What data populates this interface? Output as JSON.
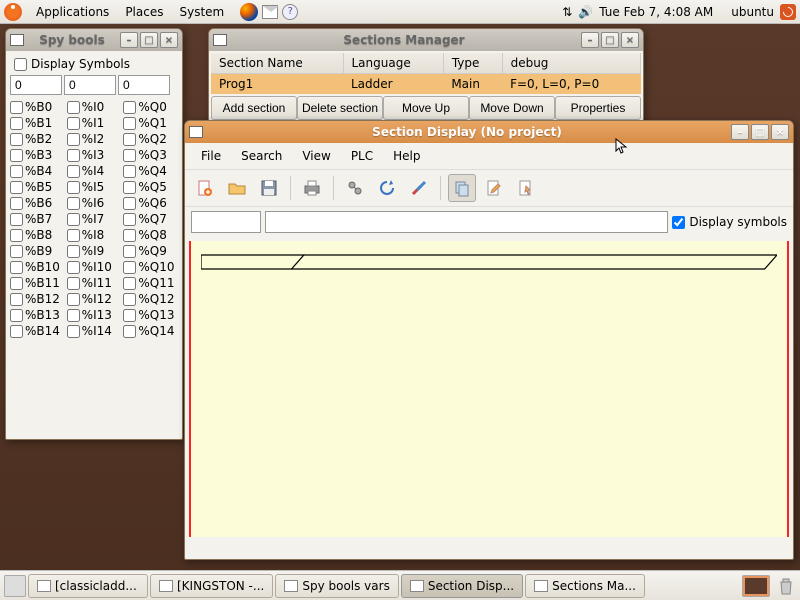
{
  "panel": {
    "menus": [
      "Applications",
      "Places",
      "System"
    ],
    "clock": "Tue Feb  7,  4:08 AM",
    "user": "ubuntu"
  },
  "spy": {
    "title": "Spy bools",
    "display_symbols": "Display Symbols",
    "inputs": [
      "0",
      "0",
      "0"
    ],
    "rows": [
      [
        "%B0",
        "%I0",
        "%Q0"
      ],
      [
        "%B1",
        "%I1",
        "%Q1"
      ],
      [
        "%B2",
        "%I2",
        "%Q2"
      ],
      [
        "%B3",
        "%I3",
        "%Q3"
      ],
      [
        "%B4",
        "%I4",
        "%Q4"
      ],
      [
        "%B5",
        "%I5",
        "%Q5"
      ],
      [
        "%B6",
        "%I6",
        "%Q6"
      ],
      [
        "%B7",
        "%I7",
        "%Q7"
      ],
      [
        "%B8",
        "%I8",
        "%Q8"
      ],
      [
        "%B9",
        "%I9",
        "%Q9"
      ],
      [
        "%B10",
        "%I10",
        "%Q10"
      ],
      [
        "%B11",
        "%I11",
        "%Q11"
      ],
      [
        "%B12",
        "%I12",
        "%Q12"
      ],
      [
        "%B13",
        "%I13",
        "%Q13"
      ],
      [
        "%B14",
        "%I14",
        "%Q14"
      ]
    ]
  },
  "sections_mgr": {
    "title": "Sections Manager",
    "cols": [
      "Section Name",
      "Language",
      "Type",
      "debug"
    ],
    "row": {
      "name": "Prog1",
      "lang": "Ladder",
      "type": "Main",
      "debug": "F=0, L=0, P=0"
    },
    "buttons": [
      "Add section",
      "Delete section",
      "Move Up",
      "Move Down",
      "Properties"
    ]
  },
  "section_display": {
    "title": "Section Display (No project)",
    "menus": [
      "File",
      "Search",
      "View",
      "PLC",
      "Help"
    ],
    "display_symbols": "Display symbols"
  },
  "taskbar": {
    "items": [
      "[classicladd...",
      "[KINGSTON -...",
      "Spy bools vars",
      "Section Disp...",
      "Sections Ma..."
    ]
  }
}
